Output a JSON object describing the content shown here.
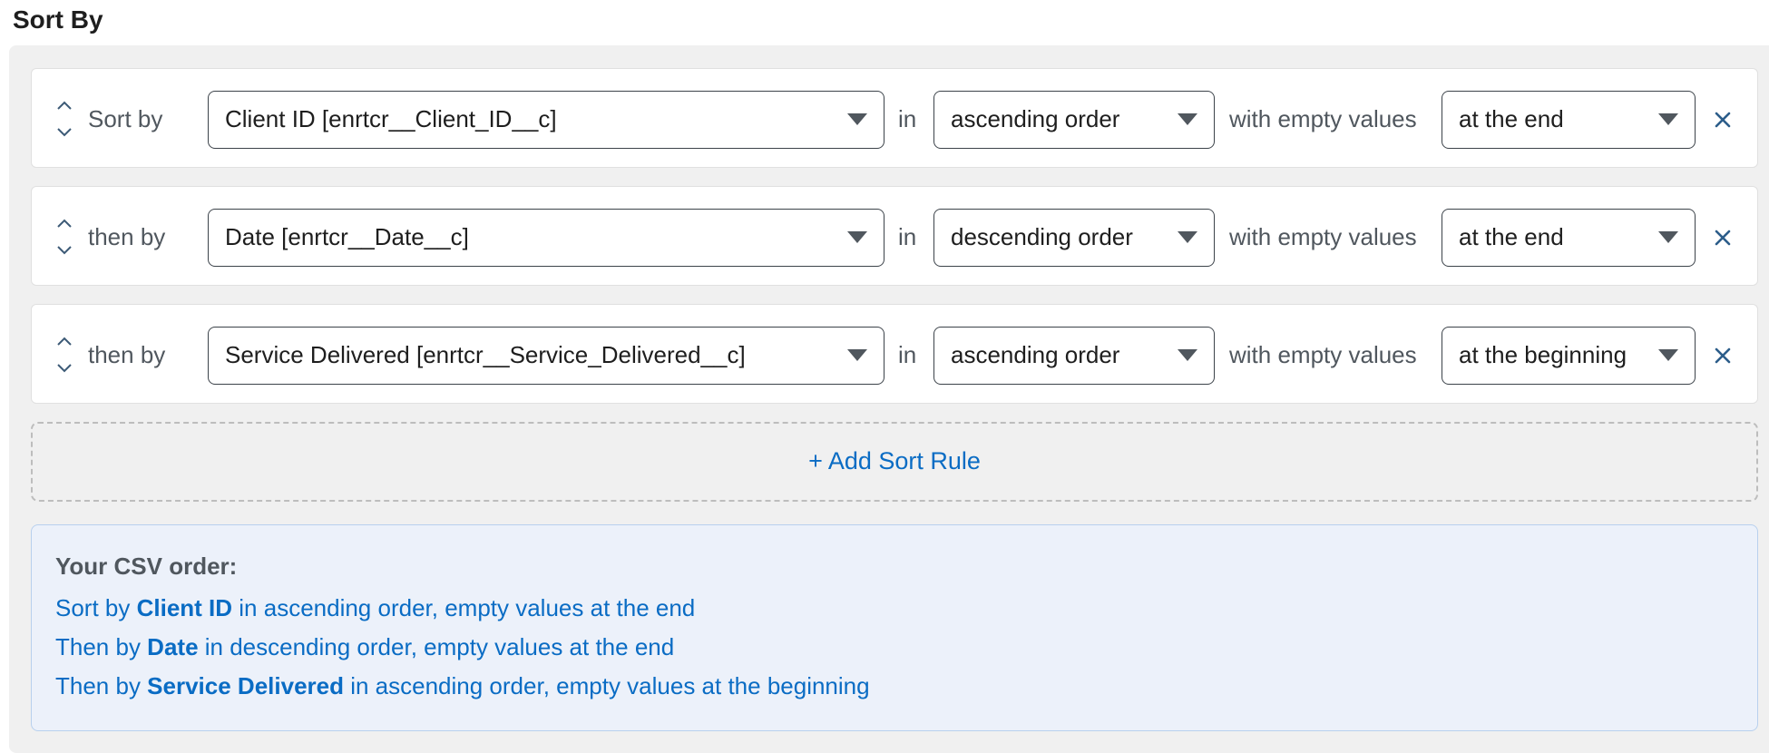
{
  "section_title": "Sort By",
  "rules": [
    {
      "label": "Sort by",
      "field": "Client ID [enrtcr__Client_ID__c]",
      "in_label": "in",
      "order": "ascending order",
      "with_label": "with empty values",
      "empty_position": "at the end"
    },
    {
      "label": "then by",
      "field": "Date [enrtcr__Date__c]",
      "in_label": "in",
      "order": "descending order",
      "with_label": "with empty values",
      "empty_position": "at the end"
    },
    {
      "label": "then by",
      "field": "Service Delivered [enrtcr__Service_Delivered__c]",
      "in_label": "in",
      "order": "ascending order",
      "with_label": "with empty values",
      "empty_position": "at the beginning"
    }
  ],
  "add_rule_label": "+ Add Sort Rule",
  "summary": {
    "title": "Your CSV order:",
    "lines": [
      {
        "prefix": "Sort by ",
        "field": "Client ID",
        "suffix": " in ascending order, empty values at the end"
      },
      {
        "prefix": "Then by ",
        "field": "Date",
        "suffix": " in descending order, empty values at the end"
      },
      {
        "prefix": "Then by ",
        "field": "Service Delivered",
        "suffix": " in ascending order, empty values at the beginning"
      }
    ]
  },
  "colors": {
    "accent": "#0a6cc4",
    "panel_bg": "#f0f0f0",
    "summary_bg": "#ecf1fa",
    "remove_icon": "#2c5d8a"
  },
  "icons": {
    "move_up": "chevron-up-icon",
    "move_down": "chevron-down-icon",
    "remove": "close-icon",
    "dropdown": "caret-down-icon"
  }
}
